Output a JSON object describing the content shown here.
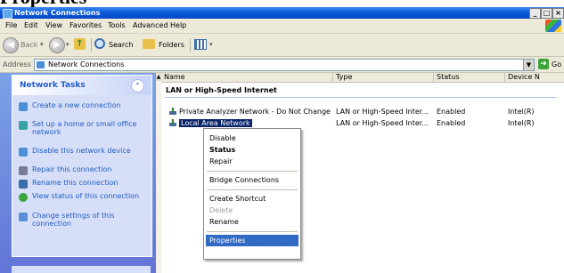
{
  "doc_heading": "Properties",
  "window": {
    "title": "Network Connections",
    "controls": [
      "_",
      "□",
      "×"
    ]
  },
  "menu": [
    "File",
    "Edit",
    "View",
    "Favorites",
    "Tools",
    "Advanced",
    "Help"
  ],
  "toolbar": {
    "back": "Back",
    "search": "Search",
    "folders": "Folders"
  },
  "address": {
    "label": "Address",
    "value": "Network Connections",
    "go": "Go"
  },
  "tasks": {
    "title": "Network Tasks",
    "items": [
      {
        "label": "Create a new connection",
        "icon": "new-connection-icon",
        "color": "#4a8fd8"
      },
      {
        "label": "Set up a home or small office network",
        "icon": "home-network-icon",
        "color": "#3aa3a3"
      },
      {
        "label": "Disable this network device",
        "icon": "disable-network-icon",
        "color": "#4a8fd8"
      },
      {
        "label": "Repair this connection",
        "icon": "repair-icon",
        "color": "#7a7a9a"
      },
      {
        "label": "Rename this connection",
        "icon": "rename-icon",
        "color": "#3a6ea8"
      },
      {
        "label": "View status of this connection",
        "icon": "status-icon",
        "color": "#3aa33a"
      },
      {
        "label": "Change settings of this connection",
        "icon": "settings-icon",
        "color": "#5a8fd8"
      }
    ]
  },
  "list": {
    "columns": [
      "Name",
      "Type",
      "Status",
      "Device N"
    ],
    "group": "LAN or High-Speed Internet",
    "rows": [
      {
        "name": "Private Analyzer Network - Do Not Change !",
        "type": "LAN or High-Speed Inter...",
        "status": "Enabled",
        "device": "Intel(R)"
      },
      {
        "name": "Local Area Network",
        "type": "LAN or High-Speed Inter...",
        "status": "Enabled",
        "device": "Intel(R)"
      }
    ]
  },
  "context_menu": {
    "items": [
      {
        "label": "Disable",
        "style": "normal"
      },
      {
        "label": "Status",
        "style": "bold"
      },
      {
        "label": "Repair",
        "style": "normal"
      },
      {
        "label": "Bridge Connections",
        "style": "normal"
      },
      {
        "label": "Create Shortcut",
        "style": "normal"
      },
      {
        "label": "Delete",
        "style": "disabled"
      },
      {
        "label": "Rename",
        "style": "normal"
      },
      {
        "label": "Properties",
        "style": "highlighted"
      }
    ]
  },
  "colors": {
    "title_bar": "#0a5ad8",
    "task_link": "#215dc6",
    "selection": "#316ac5"
  }
}
